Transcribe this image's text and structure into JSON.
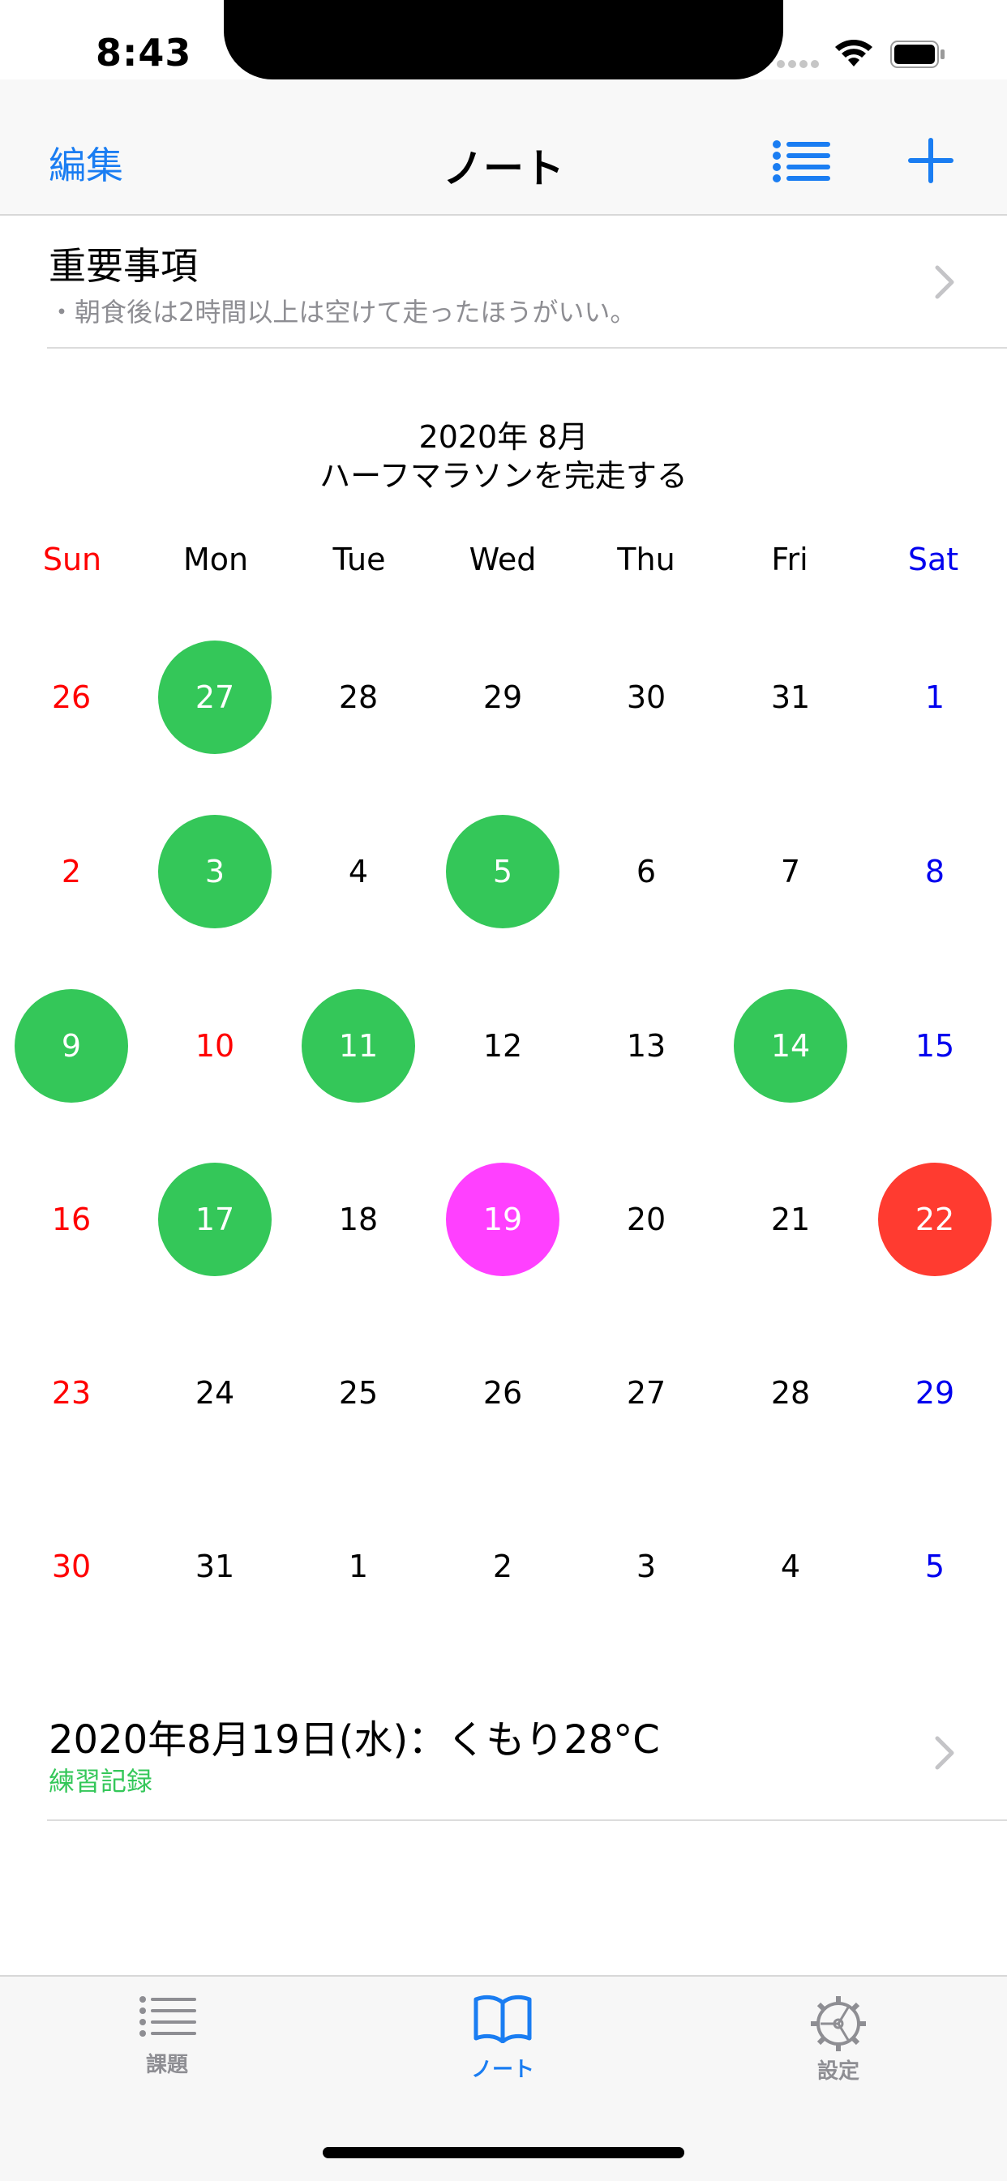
{
  "status": {
    "time": "8:43"
  },
  "nav": {
    "edit": "編集",
    "title": "ノート"
  },
  "important": {
    "title": "重要事項",
    "subtitle": "・朝食後は2時間以上は空けて走ったほうがいい。"
  },
  "calendar": {
    "month_label": "2020年 8月",
    "goal": "ハーフマラソンを完走する",
    "weekdays": [
      "Sun",
      "Mon",
      "Tue",
      "Wed",
      "Thu",
      "Fri",
      "Sat"
    ],
    "weeks": [
      [
        "26",
        "27",
        "28",
        "29",
        "30",
        "31",
        "1"
      ],
      [
        "2",
        "3",
        "4",
        "5",
        "6",
        "7",
        "8"
      ],
      [
        "9",
        "10",
        "11",
        "12",
        "13",
        "14",
        "15"
      ],
      [
        "16",
        "17",
        "18",
        "19",
        "20",
        "21",
        "22"
      ],
      [
        "23",
        "24",
        "25",
        "26",
        "27",
        "28",
        "29"
      ],
      [
        "30",
        "31",
        "1",
        "2",
        "3",
        "4",
        "5"
      ]
    ],
    "highlights": [
      {
        "week": 0,
        "day": 1,
        "color": "#34c759"
      },
      {
        "week": 1,
        "day": 1,
        "color": "#34c759"
      },
      {
        "week": 1,
        "day": 3,
        "color": "#34c759"
      },
      {
        "week": 2,
        "day": 0,
        "color": "#34c759"
      },
      {
        "week": 2,
        "day": 2,
        "color": "#34c759"
      },
      {
        "week": 2,
        "day": 5,
        "color": "#34c759"
      },
      {
        "week": 3,
        "day": 1,
        "color": "#34c759"
      },
      {
        "week": 3,
        "day": 3,
        "color": "#ff40ff"
      },
      {
        "week": 3,
        "day": 6,
        "color": "#ff3b30"
      }
    ],
    "sunday_color": "#ff0000",
    "saturday_color": "#0000ee",
    "holiday": {
      "week": 2,
      "day": 1
    }
  },
  "record": {
    "title": "2020年8月19日(水)：くもり28°C",
    "subtitle": "練習記録"
  },
  "tabs": [
    {
      "label": "課題",
      "icon": "list-icon",
      "active": false
    },
    {
      "label": "ノート",
      "icon": "book-icon",
      "active": true
    },
    {
      "label": "設定",
      "icon": "gear-icon",
      "active": false
    }
  ],
  "colors": {
    "accent": "#1a7df2",
    "green": "#34c759",
    "inactive_tab": "#8e8e93"
  }
}
